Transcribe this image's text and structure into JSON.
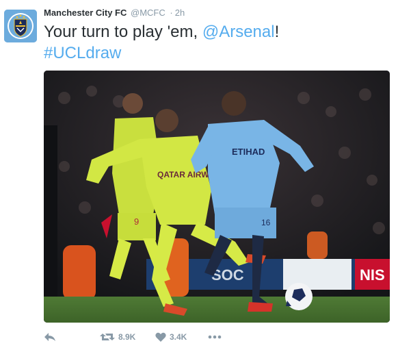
{
  "tweet": {
    "display_name": "Manchester City FC",
    "screen_name": "@MCFC",
    "separator": "·",
    "timestamp": "2h",
    "text_before": "Your turn to play 'em, ",
    "mention": "@Arsenal",
    "text_after": "!",
    "hashtag": "#UCLdraw"
  },
  "actions": {
    "reply_icon": "reply-icon",
    "retweet_icon": "retweet-icon",
    "retweet_count": "8.9K",
    "like_icon": "heart-icon",
    "like_count": "3.4K",
    "more_icon": "more-icon"
  },
  "photo": {
    "shirt_text": "QATAR AIRWAYS",
    "shirt_text_2": "ETIHAD",
    "shorts_number": "9",
    "player_number": "16",
    "board_text_1": "SOC",
    "board_text_2": "NIS"
  },
  "colors": {
    "link": "#55acee",
    "muted": "#8899a6",
    "city_blue": "#6cabdd",
    "barca_yellow": "#d4e94b"
  }
}
